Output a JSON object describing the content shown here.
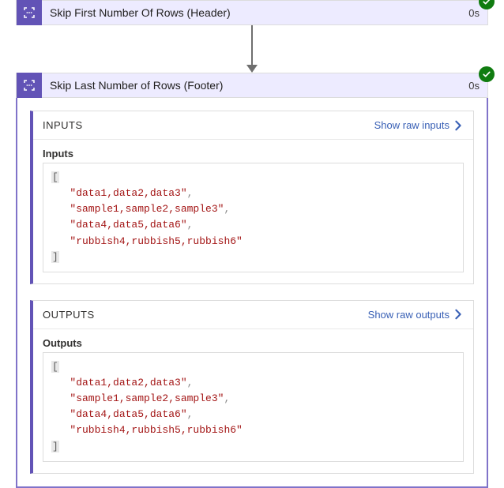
{
  "step1": {
    "title": "Skip First Number Of Rows (Header)",
    "duration": "0s"
  },
  "step2": {
    "title": "Skip Last Number of Rows (Footer)",
    "duration": "0s",
    "inputs": {
      "section_label": "INPUTS",
      "raw_link": "Show raw inputs",
      "field_label": "Inputs",
      "lines": [
        "data1,data2,data3",
        "sample1,sample2,sample3",
        "data4,data5,data6",
        "rubbish4,rubbish5,rubbish6"
      ]
    },
    "outputs": {
      "section_label": "OUTPUTS",
      "raw_link": "Show raw outputs",
      "field_label": "Outputs",
      "lines": [
        "data1,data2,data3",
        "sample1,sample2,sample3",
        "data4,data5,data6",
        "rubbish4,rubbish5,rubbish6"
      ]
    }
  }
}
